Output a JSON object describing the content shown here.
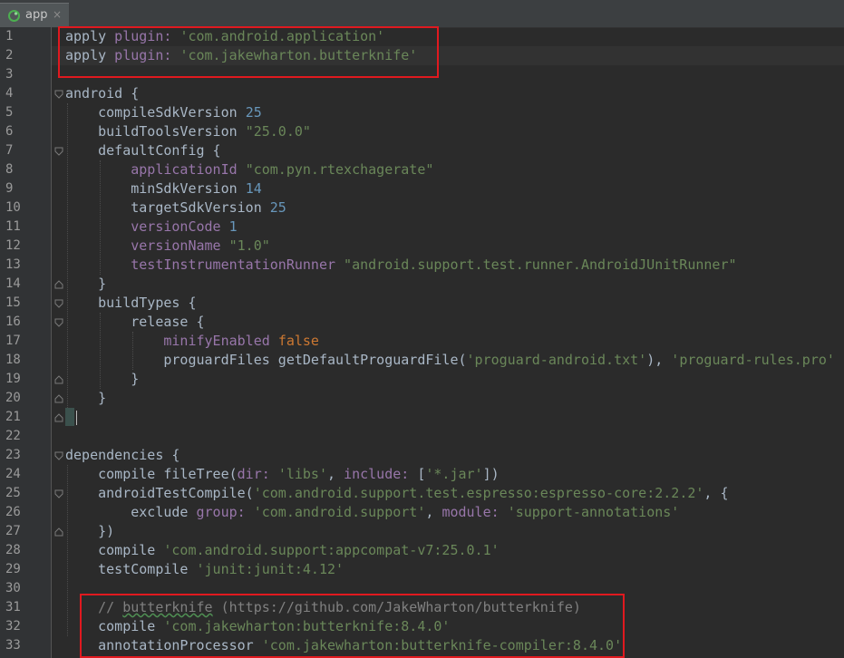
{
  "tab": {
    "label": "app",
    "close": "×",
    "icon": "gradle-icon"
  },
  "lines": [
    {
      "n": "1",
      "tokens": [
        [
          "apply",
          "kw"
        ],
        [
          " plugin: ",
          "prop"
        ],
        [
          "'com.android.application'",
          "str"
        ]
      ]
    },
    {
      "n": "2",
      "tokens": [
        [
          "apply",
          "kw"
        ],
        [
          " plugin: ",
          "prop"
        ],
        [
          "'com.jakewharton.butterknife'",
          "str"
        ]
      ]
    },
    {
      "n": "3",
      "tokens": []
    },
    {
      "n": "4",
      "tokens": [
        [
          "android {",
          "plain"
        ]
      ]
    },
    {
      "n": "5",
      "tokens": [
        [
          "    compileSdkVersion ",
          "plain"
        ],
        [
          "25",
          "num"
        ]
      ]
    },
    {
      "n": "6",
      "tokens": [
        [
          "    buildToolsVersion ",
          "plain"
        ],
        [
          "\"25.0.0\"",
          "str"
        ]
      ]
    },
    {
      "n": "7",
      "tokens": [
        [
          "    defaultConfig {",
          "plain"
        ]
      ]
    },
    {
      "n": "8",
      "tokens": [
        [
          "        applicationId ",
          "prop"
        ],
        [
          "\"com.pyn.rtexchagerate\"",
          "str"
        ]
      ]
    },
    {
      "n": "9",
      "tokens": [
        [
          "        minSdkVersion ",
          "plain"
        ],
        [
          "14",
          "num"
        ]
      ]
    },
    {
      "n": "10",
      "tokens": [
        [
          "        targetSdkVersion ",
          "plain"
        ],
        [
          "25",
          "num"
        ]
      ]
    },
    {
      "n": "11",
      "tokens": [
        [
          "        versionCode ",
          "prop"
        ],
        [
          "1",
          "num"
        ]
      ]
    },
    {
      "n": "12",
      "tokens": [
        [
          "        versionName ",
          "prop"
        ],
        [
          "\"1.0\"",
          "str"
        ]
      ]
    },
    {
      "n": "13",
      "tokens": [
        [
          "        testInstrumentationRunner ",
          "prop"
        ],
        [
          "\"android.support.test.runner.AndroidJUnitRunner\"",
          "str"
        ]
      ]
    },
    {
      "n": "14",
      "tokens": [
        [
          "    }",
          "plain"
        ]
      ]
    },
    {
      "n": "15",
      "tokens": [
        [
          "    buildTypes {",
          "plain"
        ]
      ]
    },
    {
      "n": "16",
      "tokens": [
        [
          "        release {",
          "plain"
        ]
      ]
    },
    {
      "n": "17",
      "tokens": [
        [
          "            minifyEnabled ",
          "prop"
        ],
        [
          "false",
          "bool"
        ]
      ]
    },
    {
      "n": "18",
      "tokens": [
        [
          "            proguardFiles getDefaultProguardFile(",
          "plain"
        ],
        [
          "'proguard-android.txt'",
          "str"
        ],
        [
          "), ",
          "plain"
        ],
        [
          "'proguard-rules.pro'",
          "str"
        ]
      ]
    },
    {
      "n": "19",
      "tokens": [
        [
          "        }",
          "plain"
        ]
      ]
    },
    {
      "n": "20",
      "tokens": [
        [
          "    }",
          "plain"
        ]
      ]
    },
    {
      "n": "21",
      "tokens": [
        [
          "}",
          "plain"
        ]
      ]
    },
    {
      "n": "22",
      "tokens": []
    },
    {
      "n": "23",
      "tokens": [
        [
          "dependencies {",
          "plain"
        ]
      ]
    },
    {
      "n": "24",
      "tokens": [
        [
          "    compile fileTree(",
          "plain"
        ],
        [
          "dir: ",
          "prop"
        ],
        [
          "'libs'",
          "str"
        ],
        [
          ", ",
          "plain"
        ],
        [
          "include: ",
          "prop"
        ],
        [
          "[",
          "plain"
        ],
        [
          "'*.jar'",
          "str"
        ],
        [
          "])",
          "plain"
        ]
      ]
    },
    {
      "n": "25",
      "tokens": [
        [
          "    androidTestCompile(",
          "plain"
        ],
        [
          "'com.android.support.test.espresso:espresso-core:2.2.2'",
          "str"
        ],
        [
          ", {",
          "plain"
        ]
      ]
    },
    {
      "n": "26",
      "tokens": [
        [
          "        exclude ",
          "plain"
        ],
        [
          "group: ",
          "prop"
        ],
        [
          "'com.android.support'",
          "str"
        ],
        [
          ", ",
          "plain"
        ],
        [
          "module: ",
          "prop"
        ],
        [
          "'support-annotations'",
          "str"
        ]
      ]
    },
    {
      "n": "27",
      "tokens": [
        [
          "    })",
          "plain"
        ]
      ]
    },
    {
      "n": "28",
      "tokens": [
        [
          "    compile ",
          "plain"
        ],
        [
          "'com.android.support:appcompat-v7:25.0.1'",
          "str"
        ]
      ]
    },
    {
      "n": "29",
      "tokens": [
        [
          "    testCompile ",
          "plain"
        ],
        [
          "'junit:junit:4.12'",
          "str"
        ]
      ]
    },
    {
      "n": "30",
      "tokens": []
    },
    {
      "n": "31",
      "tokens": [
        [
          "    // ",
          "cmt"
        ],
        [
          "butterknife",
          "cmt underline"
        ],
        [
          " (https://github.com/JakeWharton/butterknife)",
          "cmt"
        ]
      ]
    },
    {
      "n": "32",
      "tokens": [
        [
          "    compile ",
          "plain"
        ],
        [
          "'com.jakewharton:butterknife:8.4.0'",
          "str"
        ]
      ]
    },
    {
      "n": "33",
      "tokens": [
        [
          "    annotationProcessor ",
          "plain"
        ],
        [
          "'com.jakewharton:butterknife-compiler:8.4.0'",
          "str"
        ]
      ]
    }
  ]
}
